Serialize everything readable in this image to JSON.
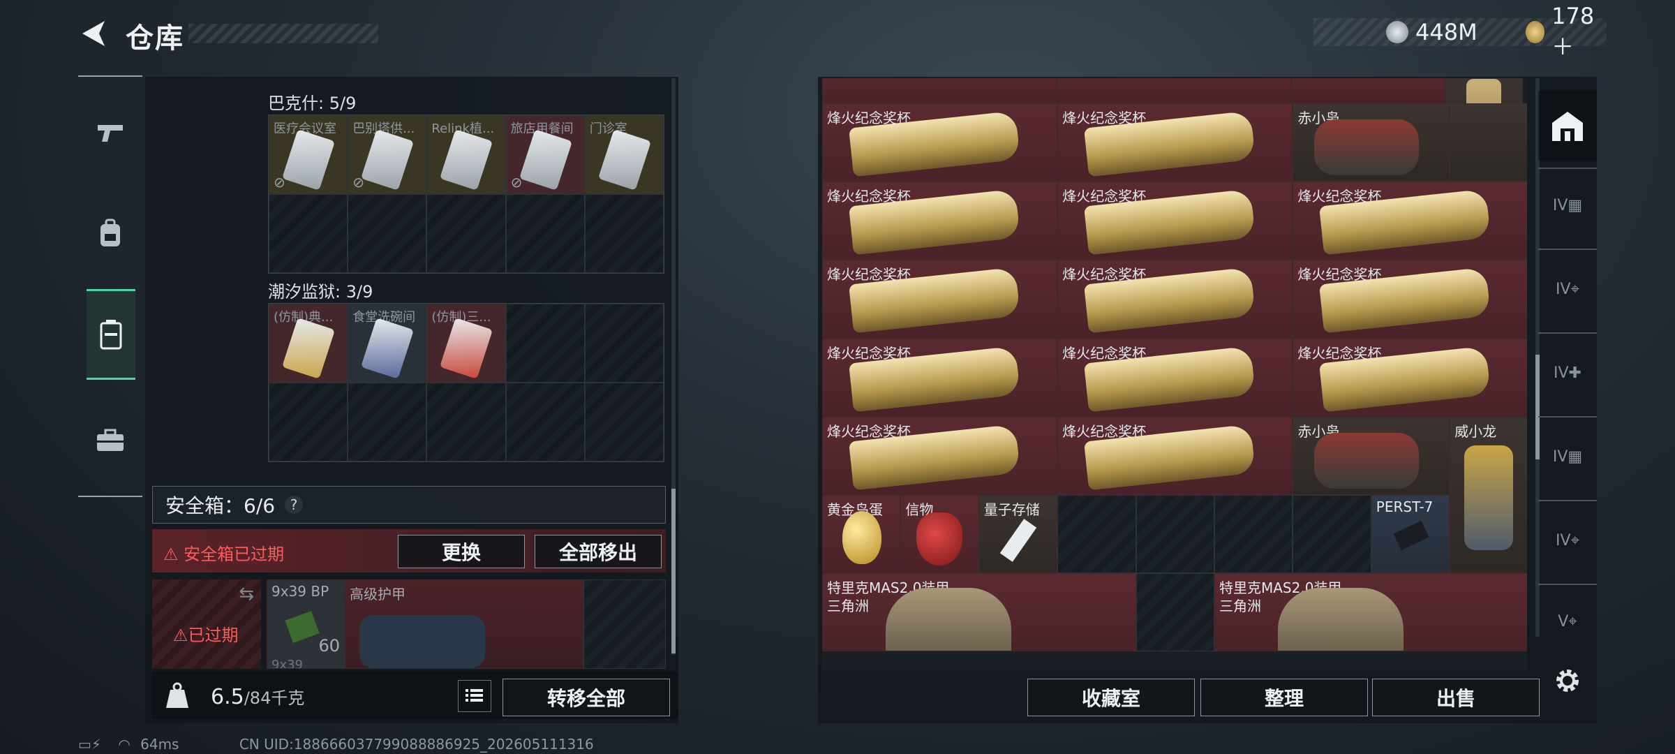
{
  "header": {
    "title": "仓库",
    "currency1": "448M",
    "currency2": "178＋"
  },
  "nav": [
    "firearm",
    "backpack",
    "container",
    "toolbox"
  ],
  "left": {
    "section1": {
      "title": "巴克什: 5/9",
      "items": [
        "医疗会议室",
        "巴别塔供...",
        "Relink植...",
        "旅店用餐间",
        "门诊室"
      ]
    },
    "section2": {
      "title": "潮汐监狱: 3/9",
      "items": [
        "(仿制)典...",
        "食堂洗碗间",
        "(仿制)三..."
      ]
    },
    "safe_box": {
      "label": "安全箱：6/6",
      "help": "?",
      "expired_notice": "安全箱已过期",
      "replace_btn": "更换",
      "move_all_btn": "全部移出",
      "expired_tag": "已过期"
    },
    "safe_items": {
      "ammo": "9x39 BP",
      "ammo_count": "60",
      "armor": "高级护甲",
      "partial": "9x39"
    },
    "weight": {
      "value": "6.5",
      "max": "/84千克"
    },
    "transfer_btn": "转移全部"
  },
  "right": {
    "trophy": "烽火纪念奖杯",
    "chixiaoxiao": "赤小枭",
    "weixiaolong": "威小龙",
    "golden_egg": "黄金鸟蛋",
    "token": "信物",
    "quantum": "量子存储",
    "perst": "PERST-7",
    "armor": "特里克MAS2.0装甲",
    "armor_sub": "三角洲",
    "btn_collection": "收藏室",
    "btn_sort": "整理",
    "btn_sell": "出售"
  },
  "toolbar_icons": [
    "stash-icon",
    "case-iv-1",
    "case-iv-2",
    "case-iv-3",
    "case-iv-4",
    "case-iv-5",
    "case-v-1"
  ],
  "status": {
    "ping": "64ms",
    "uid": "CN UID:188666037799088886925_202605111316"
  },
  "colors": {
    "accent": "#4fd6a0",
    "danger": "#ff5a5a",
    "item_red": "#5b2a31"
  }
}
